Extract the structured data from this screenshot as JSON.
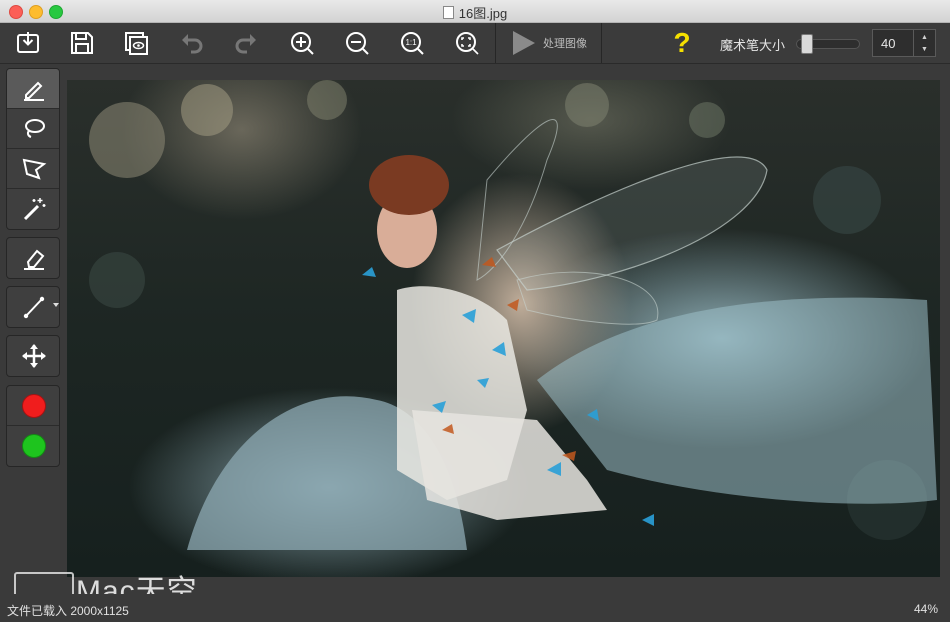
{
  "window": {
    "title": "16图.jpg"
  },
  "toolbar": {
    "process_label": "处理图像",
    "help_label": "?",
    "brush_size_label": "魔术笔大小",
    "brush_size_value": "40",
    "brush_size_fraction": 0.1,
    "buttons": [
      "import-icon",
      "save-icon",
      "preview-icon",
      "undo-icon",
      "redo-icon",
      "zoom-in-icon",
      "zoom-out-icon",
      "actual-size-icon",
      "fit-screen-icon"
    ],
    "actual_size_label": "1:1"
  },
  "tools": {
    "groups": [
      [
        "pencil-icon",
        "lasso-icon",
        "polygon-lasso-icon",
        "magic-wand-icon"
      ],
      [
        "eraser-icon"
      ],
      [
        "line-icon"
      ],
      [
        "move-icon"
      ],
      [
        "red-color",
        "green-color"
      ]
    ],
    "selected": "pencil-icon"
  },
  "colors": {
    "red": "#f01d1d",
    "green": "#1ec41e",
    "help": "#f5e000"
  },
  "watermark": {
    "text": "Mac天空"
  },
  "status": {
    "file_info": "文件已载入 2000x1125",
    "zoom": "44%"
  }
}
